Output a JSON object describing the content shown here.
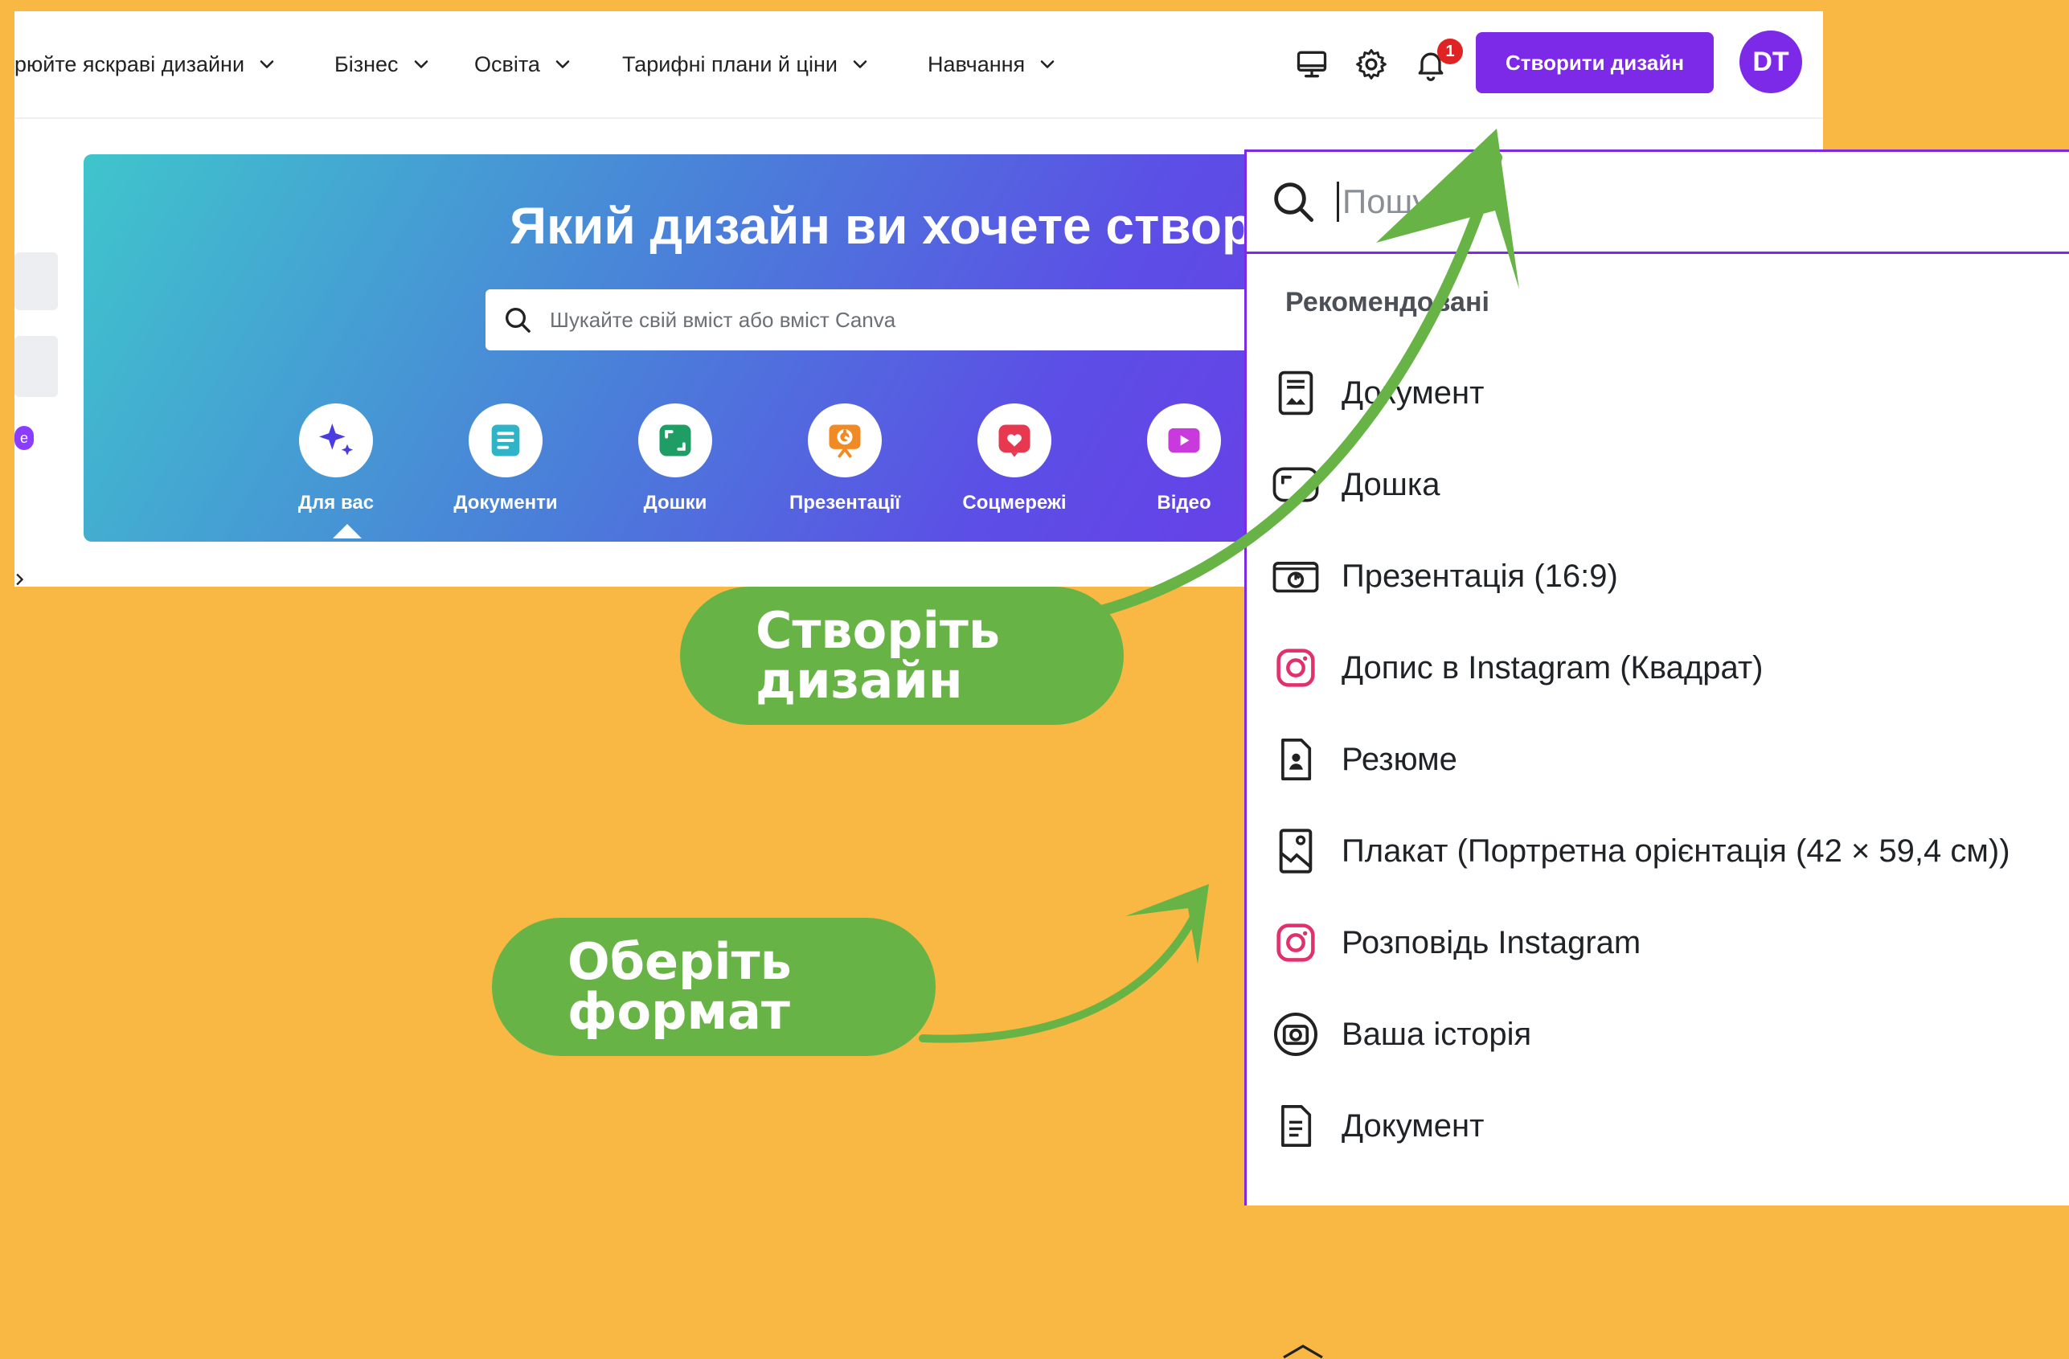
{
  "nav": {
    "items": [
      {
        "label": "рюйте яскраві дизайни"
      },
      {
        "label": "Бізнес"
      },
      {
        "label": "Освіта"
      },
      {
        "label": "Тарифні плани й ціни"
      },
      {
        "label": "Навчання"
      }
    ],
    "notification_count": "1",
    "create_button": "Створити дизайн",
    "avatar_initials": "DT",
    "icons": [
      "monitor-icon",
      "gear-icon",
      "bell-icon"
    ]
  },
  "sidebar": {
    "badge": "e"
  },
  "hero": {
    "title": "Який дизайн ви хочете створ",
    "search_placeholder": "Шукайте свій вміст або вміст Canva",
    "categories": [
      {
        "label": "Для вас",
        "icon": "sparkle-icon",
        "color": "#4B3CE0"
      },
      {
        "label": "Документи",
        "icon": "document-icon",
        "color": "#2FB3C6"
      },
      {
        "label": "Дошки",
        "icon": "whiteboard-icon",
        "color": "#1E9E64"
      },
      {
        "label": "Презентації",
        "icon": "presentation-icon",
        "color": "#F08A24"
      },
      {
        "label": "Соцмережі",
        "icon": "heart-icon",
        "color": "#E8384F"
      },
      {
        "label": "Відео",
        "icon": "video-icon",
        "color": "#C83ADB"
      }
    ]
  },
  "dropdown": {
    "search_placeholder": "Пошук",
    "section_title": "Рекомендовані",
    "items": [
      {
        "label": "Документ",
        "icon": "document-icon"
      },
      {
        "label": "Дошка",
        "icon": "whiteboard-icon"
      },
      {
        "label": "Презентація (16:9)",
        "icon": "presentation-icon"
      },
      {
        "label": "Допис в Instagram (Квадрат)",
        "icon": "instagram-icon"
      },
      {
        "label": "Резюме",
        "icon": "resume-icon"
      },
      {
        "label": "Плакат (Портретна орієнтація (42 × 59,4 см))",
        "icon": "poster-icon"
      },
      {
        "label": "Розповідь Instagram",
        "icon": "instagram-icon"
      },
      {
        "label": "Ваша історія",
        "icon": "camera-icon"
      },
      {
        "label": "Документ",
        "icon": "doc-lines-icon"
      }
    ]
  },
  "callouts": {
    "create": {
      "line1": "Створіть",
      "line2": "дизайн"
    },
    "format": {
      "line1": "Оберіть",
      "line2": "формат"
    }
  },
  "colors": {
    "background": "#F8B843",
    "accent": "#7D2AE8",
    "callout": "#67B346"
  }
}
